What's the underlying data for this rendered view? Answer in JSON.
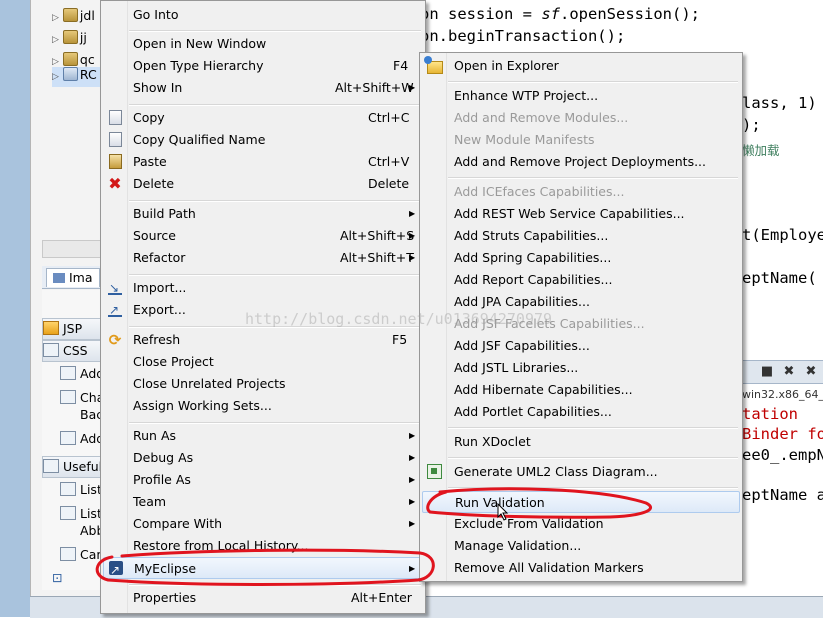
{
  "tree": {
    "items": [
      {
        "label": "jdl",
        "type": "jar"
      },
      {
        "label": "jj",
        "type": "jar"
      },
      {
        "label": "qc",
        "type": "jar"
      },
      {
        "label": "RC",
        "type": "project"
      }
    ]
  },
  "tabs": {
    "left_tab": "Ima"
  },
  "palette": {
    "header1": "JSP",
    "header2": "CSS",
    "items_css": [
      "Add",
      "Cha",
      "Bac",
      "Add"
    ],
    "header3": "Useful",
    "items_useful": [
      "List",
      "List",
      "Abb",
      "Can"
    ]
  },
  "code": {
    "line1_a": "on session = ",
    "line1_b": "sf",
    "line1_c": ".openSession();",
    "line2": "on.beginTransaction();",
    "line3": "lass, 1)",
    "line4": ");",
    "line5_comment": "懒加载",
    "line6": "t(Employe",
    "line7": "eptName(",
    "console_path": "win32.x86_64_",
    "console_line1": "tation",
    "console_line2": "Binder fo",
    "console_line3": "ee0_.empN",
    "console_line4": "eptName a"
  },
  "watermark": "http://blog.csdn.net/u013694270979",
  "context_menu": {
    "go_into": "Go Into",
    "open_new_window": "Open in New Window",
    "open_type_hierarchy": {
      "label": "Open Type Hierarchy",
      "shortcut": "F4"
    },
    "show_in": {
      "label": "Show In",
      "shortcut": "Alt+Shift+W"
    },
    "copy": {
      "label": "Copy",
      "shortcut": "Ctrl+C"
    },
    "copy_qualified": "Copy Qualified Name",
    "paste": {
      "label": "Paste",
      "shortcut": "Ctrl+V"
    },
    "delete": {
      "label": "Delete",
      "shortcut": "Delete"
    },
    "build_path": "Build Path",
    "source": {
      "label": "Source",
      "shortcut": "Alt+Shift+S"
    },
    "refactor": {
      "label": "Refactor",
      "shortcut": "Alt+Shift+T"
    },
    "import": "Import...",
    "export": "Export...",
    "refresh": {
      "label": "Refresh",
      "shortcut": "F5"
    },
    "close_project": "Close Project",
    "close_unrelated": "Close Unrelated Projects",
    "assign_working_sets": "Assign Working Sets...",
    "run_as": "Run As",
    "debug_as": "Debug As",
    "profile_as": "Profile As",
    "team": "Team",
    "compare_with": "Compare With",
    "restore_history": "Restore from Local History...",
    "myeclipse": "MyEclipse",
    "properties": {
      "label": "Properties",
      "shortcut": "Alt+Enter"
    }
  },
  "submenu": {
    "open_in_explorer": "Open in Explorer",
    "enhance_wtp": "Enhance WTP Project...",
    "add_remove_modules": "Add and Remove Modules...",
    "new_module_manifests": "New Module Manifests",
    "add_remove_deployments": "Add and Remove Project Deployments...",
    "add_icefaces": "Add ICEfaces Capabilities...",
    "add_rest": "Add REST Web Service Capabilities...",
    "add_struts": "Add Struts Capabilities...",
    "add_spring": "Add Spring Capabilities...",
    "add_report": "Add Report Capabilities...",
    "add_jpa": "Add JPA Capabilities...",
    "add_jsf_facelets": "Add JSF Facelets Capabilities...",
    "add_jsf": "Add JSF Capabilities...",
    "add_jstl": "Add JSTL Libraries...",
    "add_hibernate": "Add Hibernate Capabilities...",
    "add_portlet": "Add Portlet Capabilities...",
    "run_xdoclet": "Run XDoclet",
    "generate_uml2": "Generate UML2 Class Diagram...",
    "run_validation": "Run Validation",
    "exclude_validation": "Exclude From Validation",
    "manage_validation": "Manage Validation...",
    "remove_markers": "Remove All Validation Markers"
  },
  "colors": {
    "annotation_red": "#e0141e",
    "menu_bg": "#f0f0f0",
    "highlight_border": "#aecbee",
    "keyword": "#7f0055"
  }
}
